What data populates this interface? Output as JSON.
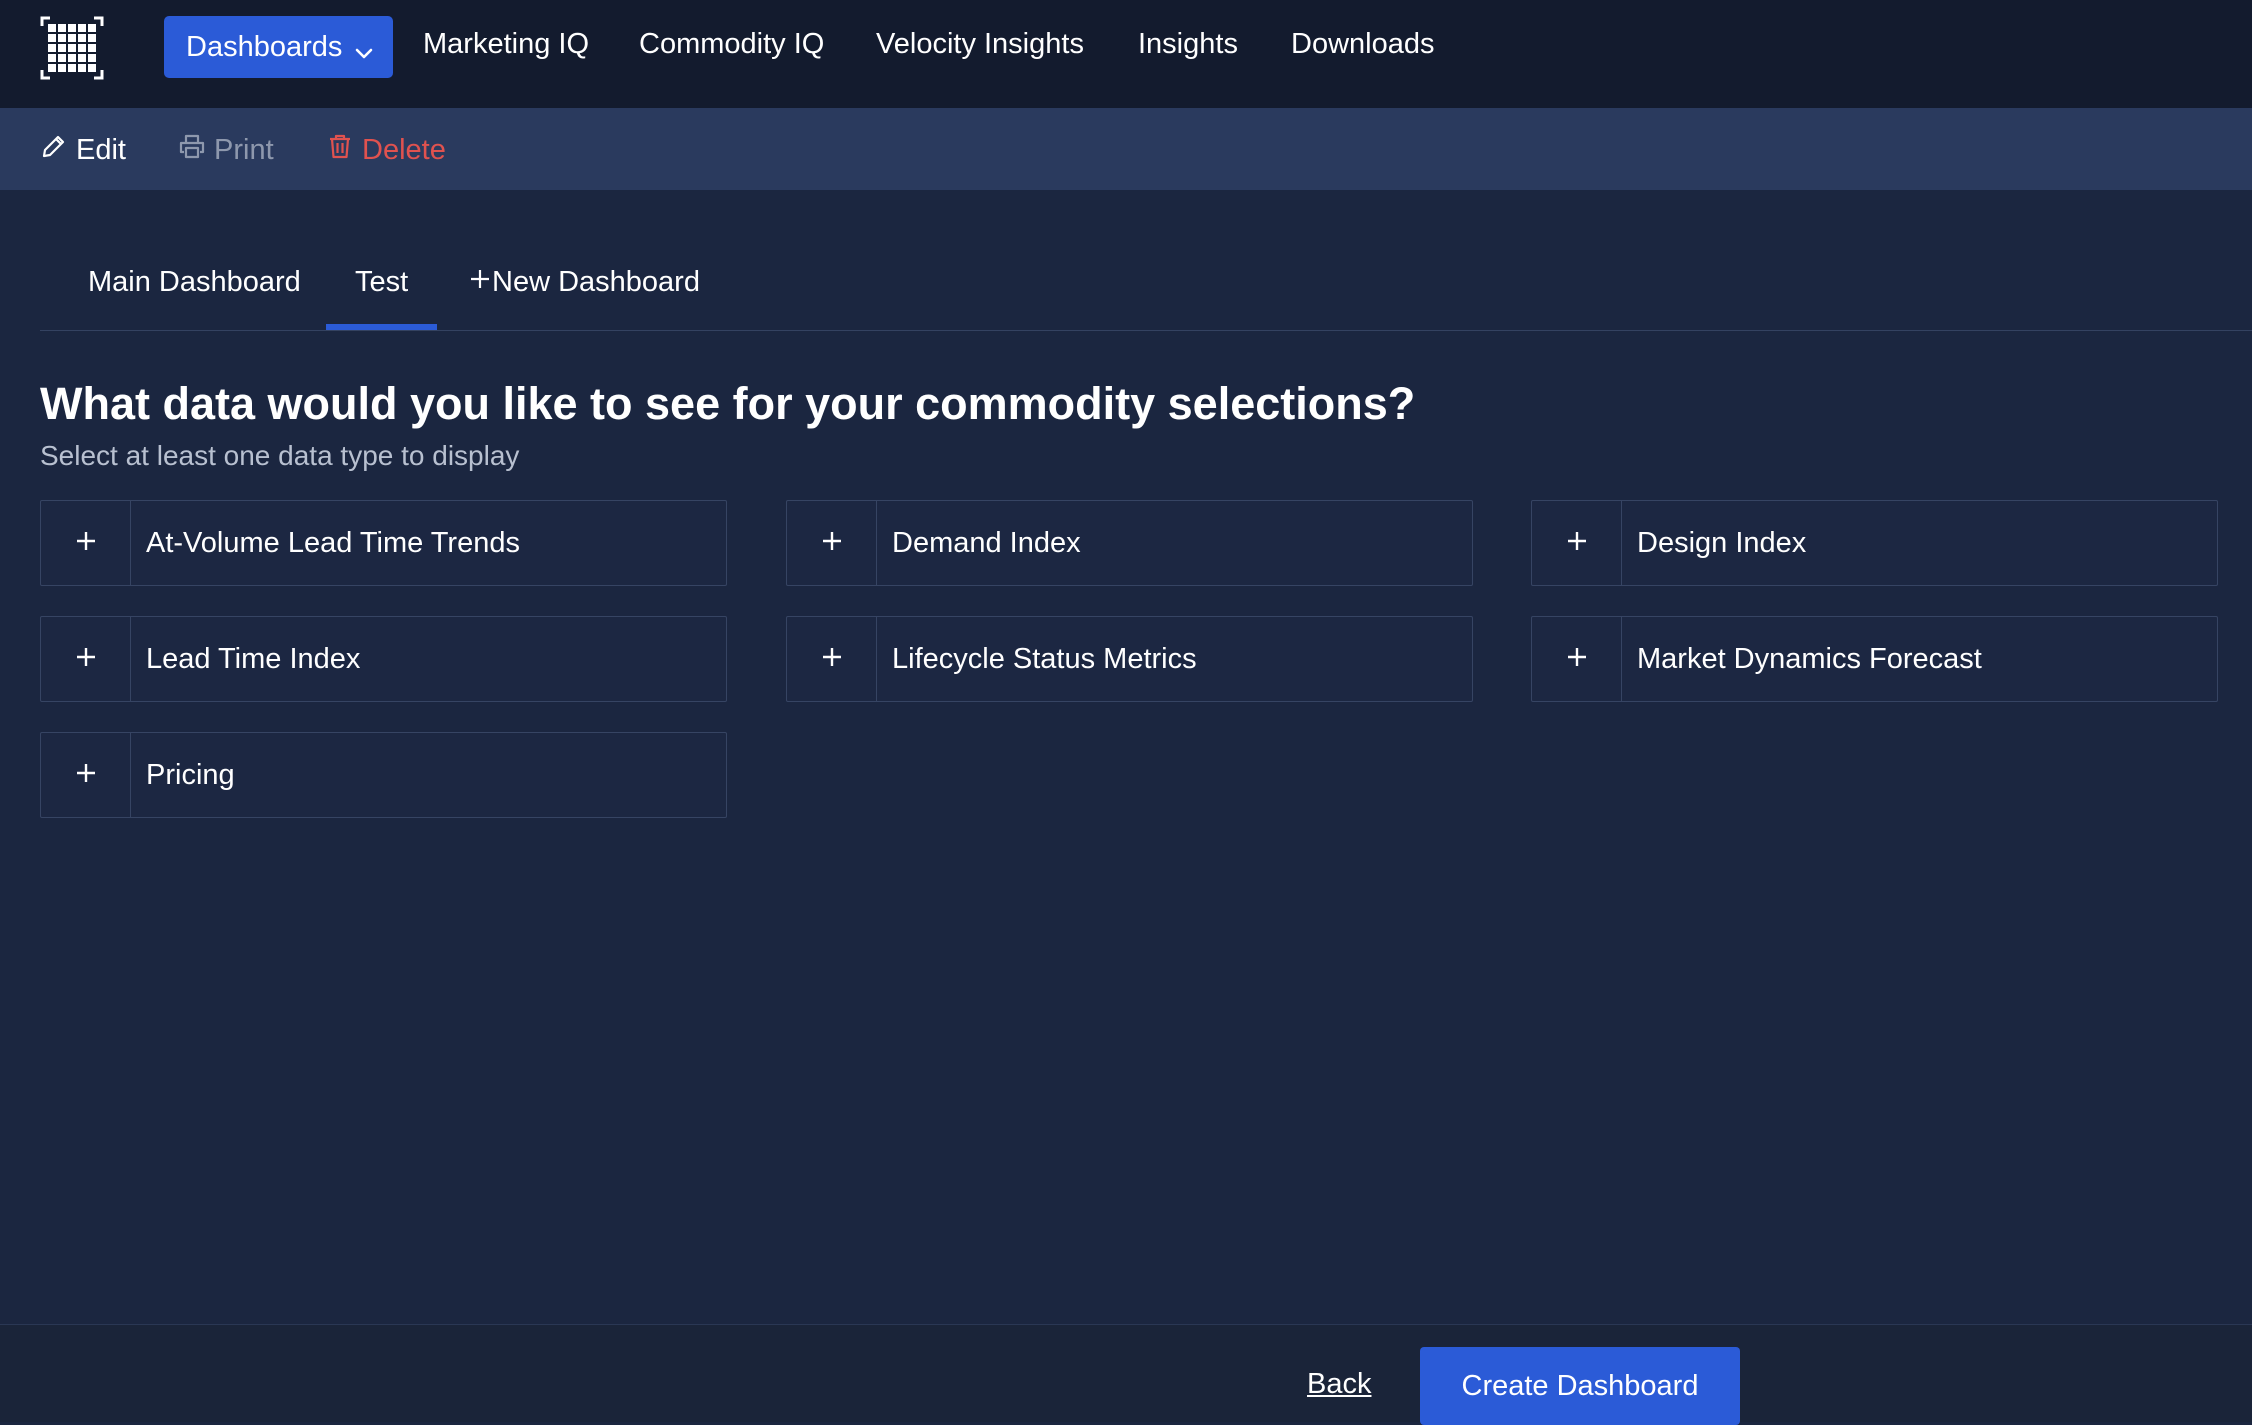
{
  "nav": {
    "logo_icon": "grid-logo-icon",
    "dashboards_label": "Dashboards",
    "items": [
      "Marketing IQ",
      "Commodity IQ",
      "Velocity Insights",
      "Insights",
      "Downloads"
    ]
  },
  "toolbar": {
    "edit_label": "Edit",
    "print_label": "Print",
    "delete_label": "Delete"
  },
  "tabs": {
    "items": [
      "Main Dashboard",
      "Test"
    ],
    "active": "Test",
    "new_label": "New Dashboard"
  },
  "main": {
    "heading": "What data would you like to see for your commodity selections?",
    "subheading": "Select at least one data type to display",
    "options": [
      "At-Volume Lead Time Trends",
      "Demand Index",
      "Design Index",
      "Lead Time Index",
      "Lifecycle Status Metrics",
      "Market Dynamics Forecast",
      "Pricing"
    ]
  },
  "footer": {
    "back_label": "Back",
    "create_label": "Create Dashboard"
  },
  "colors": {
    "accent": "#2b5bd7",
    "nav_bg": "#131b2e",
    "toolbar_bg": "#2a3a5e",
    "page_bg": "#1b2640",
    "delete": "#e0524f"
  }
}
